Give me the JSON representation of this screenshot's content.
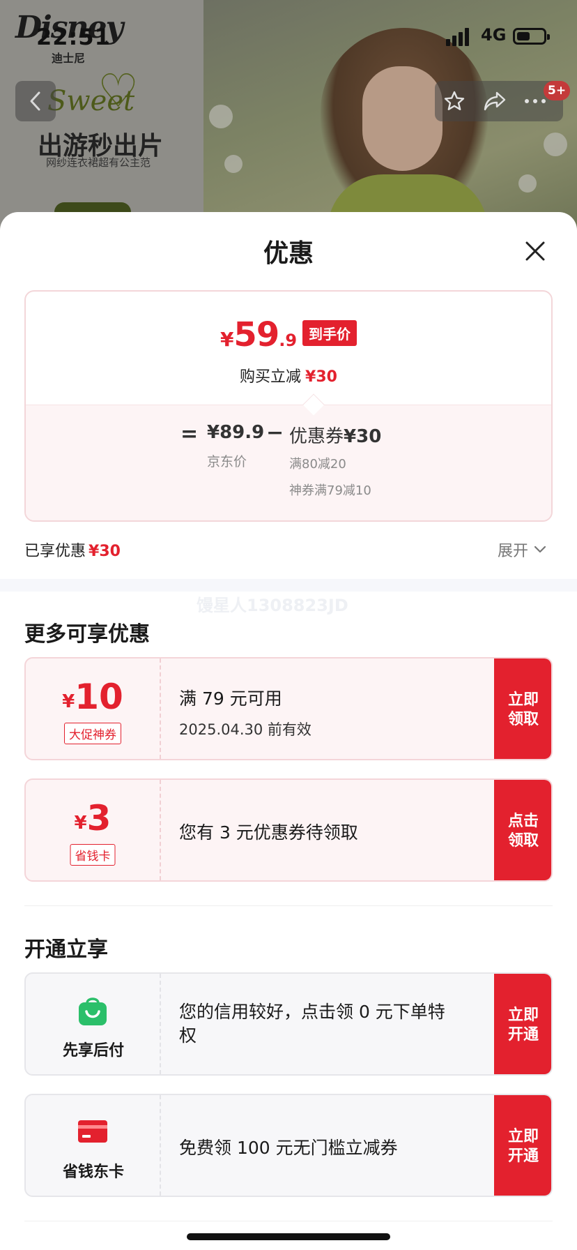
{
  "status_bar": {
    "time": "22:51",
    "network": "4G"
  },
  "background": {
    "brand": "Disney",
    "brand_cn": "迪士尼",
    "sweet": "Sweet",
    "promo_title": "出游秒出片",
    "promo_sub": "网纱连衣裙超有公主范",
    "badge": "5+"
  },
  "sheet": {
    "title": "优惠",
    "price_summary": {
      "yen": "¥",
      "price_int": "59",
      "price_dec": ".9",
      "tag": "到手价",
      "reduce_label": "购买立减",
      "reduce_amount": "¥30",
      "equals": "=",
      "jd_price": "¥89.9",
      "jd_label": "京东价",
      "minus": "−",
      "coupon_label": "优惠券",
      "coupon_amount": "¥30",
      "coupon_detail_1": "满80减20",
      "coupon_detail_2": "神券满79减10"
    },
    "enjoyed_label": "已享优惠",
    "enjoyed_amount": "¥30",
    "expand_label": "展开",
    "watermark": "馒星人1308823JD",
    "more_section_title": "更多可享优惠",
    "coupons": [
      {
        "yen": "¥",
        "amount": "10",
        "tag": "大促神券",
        "line1": "满 79 元可用",
        "line2": "2025.04.30 前有效",
        "button": "立即领取"
      },
      {
        "yen": "¥",
        "amount": "3",
        "tag": "省钱卡",
        "line1": "您有 3 元优惠券待领取",
        "button": "点击领取"
      }
    ],
    "open_section_title": "开通立享",
    "services": [
      {
        "icon": "green-shopping-bag-icon",
        "label": "先享后付",
        "text": "您的信用较好，点击领 0 元下单特权",
        "button": "立即开通"
      },
      {
        "icon": "red-card-icon",
        "label": "省钱东卡",
        "text": "免费领 100 元无门槛立减券",
        "button": "立即开通"
      }
    ]
  },
  "colors": {
    "accent": "#e3212e",
    "coupon_bg": "#fdf4f5",
    "service_bg": "#f7f7f9",
    "green_icon": "#2bbf6a"
  }
}
